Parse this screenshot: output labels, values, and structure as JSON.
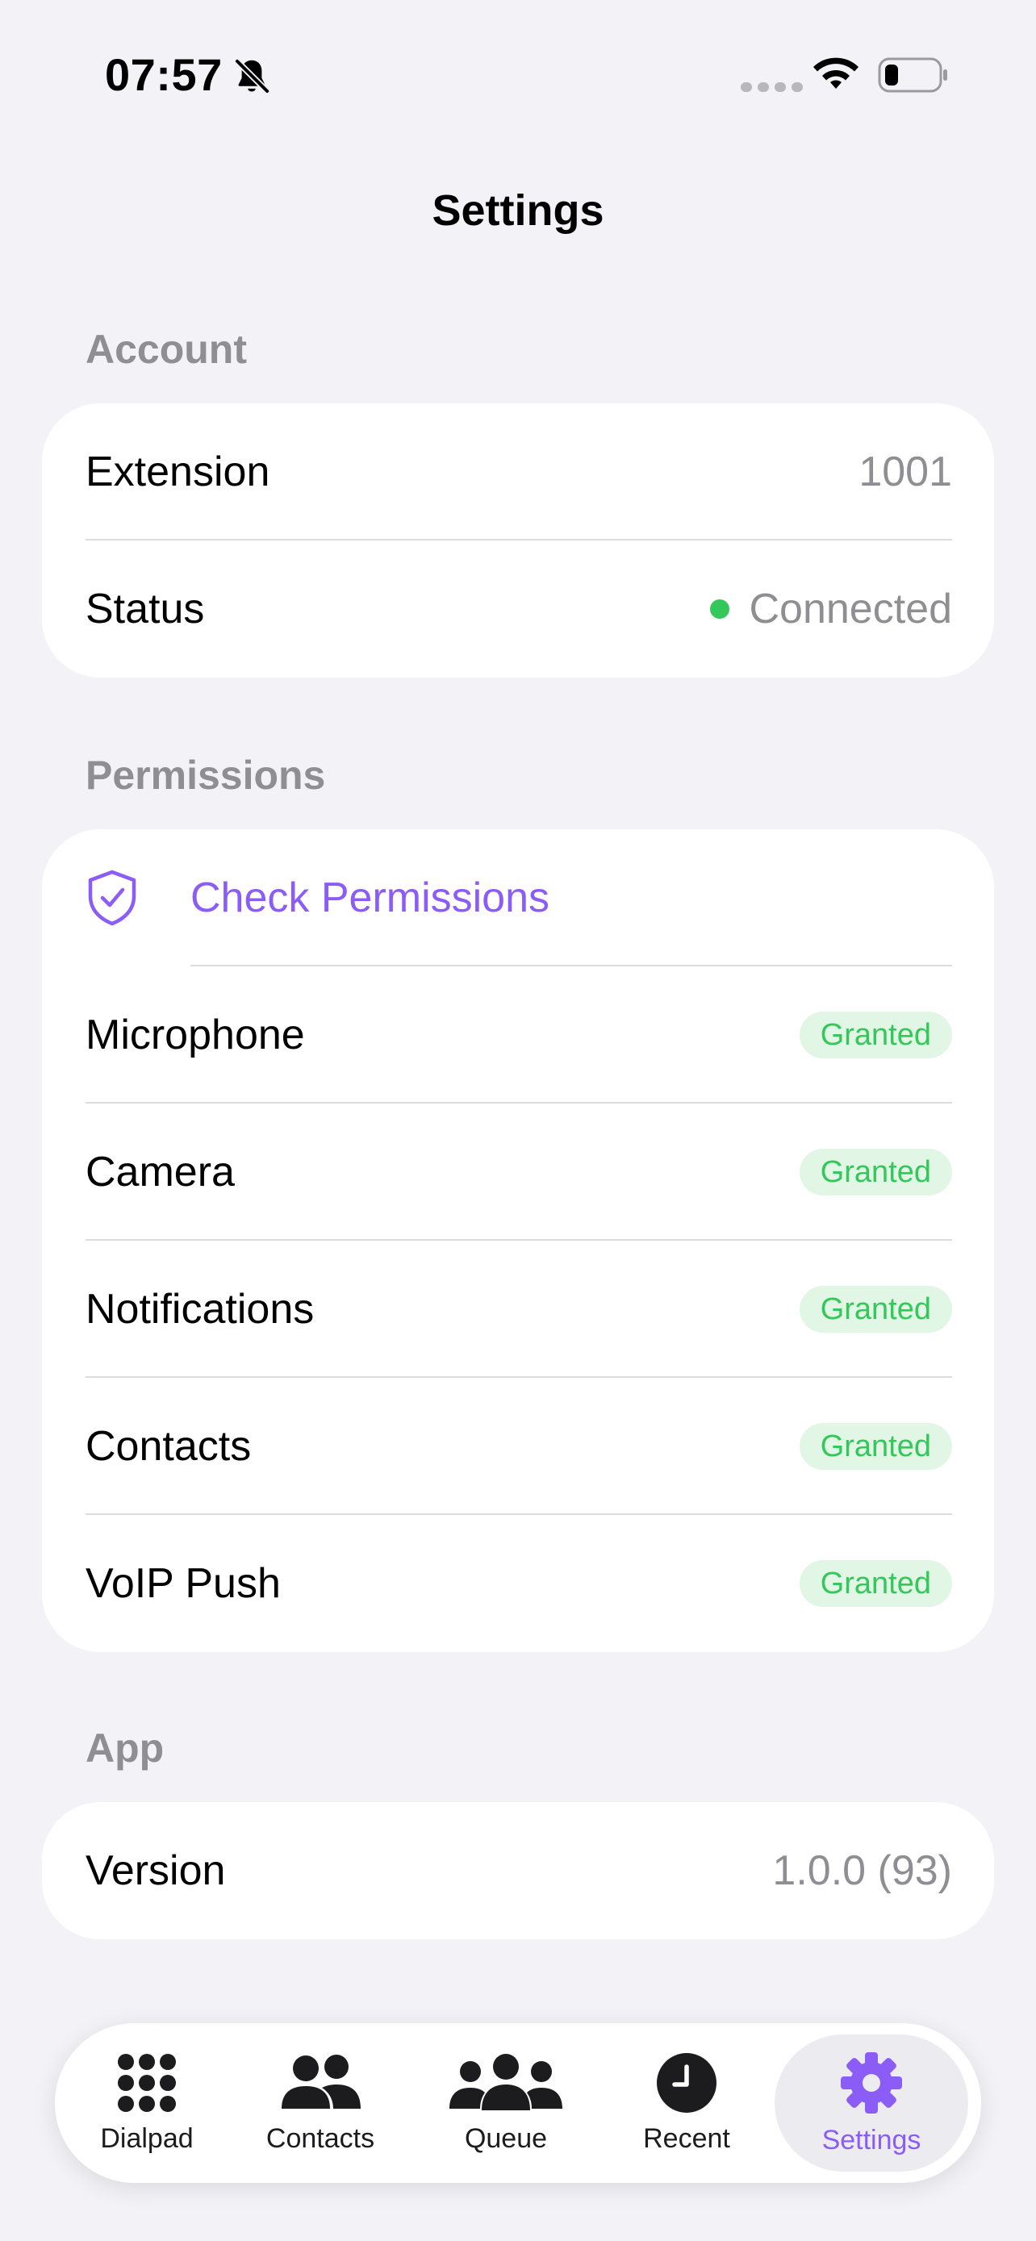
{
  "status_bar": {
    "time": "07:57",
    "icons": [
      "bell-slash-icon",
      "signal-icon",
      "wifi-icon",
      "battery-icon"
    ]
  },
  "nav": {
    "title": "Settings"
  },
  "account": {
    "header": "Account",
    "rows": [
      {
        "label": "Extension",
        "value": "1001"
      },
      {
        "label": "Status",
        "value": "Connected"
      }
    ]
  },
  "permissions": {
    "header": "Permissions",
    "check_label": "Check Permissions",
    "rows": [
      {
        "label": "Microphone",
        "badge": "Granted"
      },
      {
        "label": "Camera",
        "badge": "Granted"
      },
      {
        "label": "Notifications",
        "badge": "Granted"
      },
      {
        "label": "Contacts",
        "badge": "Granted"
      },
      {
        "label": "VoIP Push",
        "badge": "Granted"
      }
    ]
  },
  "app": {
    "header": "App",
    "rows": [
      {
        "label": "Version",
        "value": "1.0.0 (93)"
      }
    ]
  },
  "tabbar": {
    "tabs": [
      {
        "label": "Dialpad",
        "icon": "dialpad-icon"
      },
      {
        "label": "Contacts",
        "icon": "contacts-icon"
      },
      {
        "label": "Queue",
        "icon": "queue-icon"
      },
      {
        "label": "Recent",
        "icon": "clock-icon"
      },
      {
        "label": "Settings",
        "icon": "gear-icon",
        "active": true
      }
    ]
  },
  "colors": {
    "accent": "#8b5cf6",
    "success": "#34c759",
    "background": "#f2f2f7",
    "secondary_text": "#8e8e93"
  }
}
